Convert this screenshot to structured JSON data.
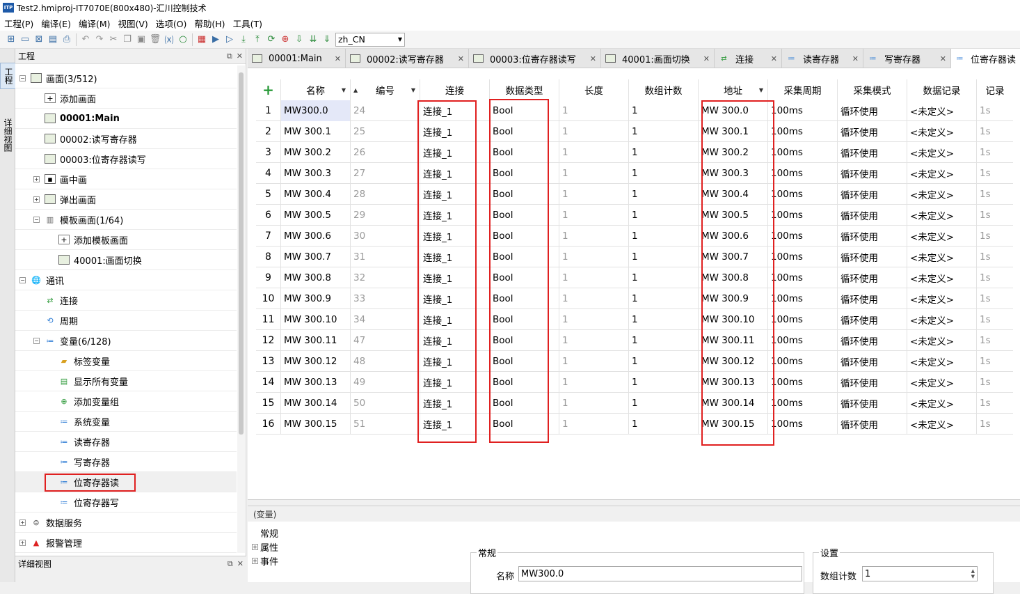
{
  "window": {
    "title": "Test2.hmiproj-IT7070E(800x480)-汇川控制技术",
    "logo_text": "ITP"
  },
  "menu": [
    "工程(P)",
    "编译(E)",
    "编译(M)",
    "视图(V)",
    "选项(O)",
    "帮助(H)",
    "工具(T)"
  ],
  "toolbar": {
    "language": "zh_CN"
  },
  "sidetabs": [
    "工程",
    "详细视图"
  ],
  "project_panel": {
    "title": "工程",
    "tree": [
      {
        "label": "画面(3/512)",
        "bold": false
      },
      {
        "label": "添加画面",
        "bold": false
      },
      {
        "label": "00001:Main",
        "bold": true
      },
      {
        "label": "00002:读写寄存器",
        "bold": false
      },
      {
        "label": "00003:位寄存器读写",
        "bold": false
      },
      {
        "label": "画中画",
        "bold": false
      },
      {
        "label": "弹出画面",
        "bold": false
      },
      {
        "label": "模板画面(1/64)",
        "bold": false
      },
      {
        "label": "添加模板画面",
        "bold": false
      },
      {
        "label": "40001:画面切换",
        "bold": false
      },
      {
        "label": "通讯",
        "bold": false
      },
      {
        "label": "连接",
        "bold": false
      },
      {
        "label": "周期",
        "bold": false
      },
      {
        "label": "变量(6/128)",
        "bold": false
      },
      {
        "label": "标签变量",
        "bold": false
      },
      {
        "label": "显示所有变量",
        "bold": false
      },
      {
        "label": "添加变量组",
        "bold": false
      },
      {
        "label": "系统变量",
        "bold": false
      },
      {
        "label": "读寄存器",
        "bold": false
      },
      {
        "label": "写寄存器",
        "bold": false
      },
      {
        "label": "位寄存器读",
        "bold": false
      },
      {
        "label": "位寄存器写",
        "bold": false
      },
      {
        "label": "数据服务",
        "bold": false
      },
      {
        "label": "报警管理",
        "bold": false
      }
    ]
  },
  "detail_panel": {
    "title": "详细视图"
  },
  "tabs": [
    {
      "label": "00001:Main"
    },
    {
      "label": "00002:读写寄存器"
    },
    {
      "label": "00003:位寄存器读写"
    },
    {
      "label": "40001:画面切换"
    },
    {
      "label": "连接"
    },
    {
      "label": "读寄存器"
    },
    {
      "label": "写寄存器"
    },
    {
      "label": "位寄存器读"
    }
  ],
  "grid": {
    "add_symbol": "+",
    "headers": [
      "名称",
      "编号",
      "连接",
      "数据类型",
      "长度",
      "数组计数",
      "地址",
      "采集周期",
      "采集模式",
      "数据记录",
      "记录"
    ],
    "rows": [
      [
        "1",
        "MW300.0",
        "24",
        "连接_1",
        "Bool",
        "1",
        "1",
        "MW 300.0",
        "100ms",
        "循环使用",
        "<未定义>",
        "1s"
      ],
      [
        "2",
        "MW 300.1",
        "25",
        "连接_1",
        "Bool",
        "1",
        "1",
        "MW 300.1",
        "100ms",
        "循环使用",
        "<未定义>",
        "1s"
      ],
      [
        "3",
        "MW 300.2",
        "26",
        "连接_1",
        "Bool",
        "1",
        "1",
        "MW 300.2",
        "100ms",
        "循环使用",
        "<未定义>",
        "1s"
      ],
      [
        "4",
        "MW 300.3",
        "27",
        "连接_1",
        "Bool",
        "1",
        "1",
        "MW 300.3",
        "100ms",
        "循环使用",
        "<未定义>",
        "1s"
      ],
      [
        "5",
        "MW 300.4",
        "28",
        "连接_1",
        "Bool",
        "1",
        "1",
        "MW 300.4",
        "100ms",
        "循环使用",
        "<未定义>",
        "1s"
      ],
      [
        "6",
        "MW 300.5",
        "29",
        "连接_1",
        "Bool",
        "1",
        "1",
        "MW 300.5",
        "100ms",
        "循环使用",
        "<未定义>",
        "1s"
      ],
      [
        "7",
        "MW 300.6",
        "30",
        "连接_1",
        "Bool",
        "1",
        "1",
        "MW 300.6",
        "100ms",
        "循环使用",
        "<未定义>",
        "1s"
      ],
      [
        "8",
        "MW 300.7",
        "31",
        "连接_1",
        "Bool",
        "1",
        "1",
        "MW 300.7",
        "100ms",
        "循环使用",
        "<未定义>",
        "1s"
      ],
      [
        "9",
        "MW 300.8",
        "32",
        "连接_1",
        "Bool",
        "1",
        "1",
        "MW 300.8",
        "100ms",
        "循环使用",
        "<未定义>",
        "1s"
      ],
      [
        "10",
        "MW 300.9",
        "33",
        "连接_1",
        "Bool",
        "1",
        "1",
        "MW 300.9",
        "100ms",
        "循环使用",
        "<未定义>",
        "1s"
      ],
      [
        "11",
        "MW 300.10",
        "34",
        "连接_1",
        "Bool",
        "1",
        "1",
        "MW 300.10",
        "100ms",
        "循环使用",
        "<未定义>",
        "1s"
      ],
      [
        "12",
        "MW 300.11",
        "47",
        "连接_1",
        "Bool",
        "1",
        "1",
        "MW 300.11",
        "100ms",
        "循环使用",
        "<未定义>",
        "1s"
      ],
      [
        "13",
        "MW 300.12",
        "48",
        "连接_1",
        "Bool",
        "1",
        "1",
        "MW 300.12",
        "100ms",
        "循环使用",
        "<未定义>",
        "1s"
      ],
      [
        "14",
        "MW 300.13",
        "49",
        "连接_1",
        "Bool",
        "1",
        "1",
        "MW 300.13",
        "100ms",
        "循环使用",
        "<未定义>",
        "1s"
      ],
      [
        "15",
        "MW 300.14",
        "50",
        "连接_1",
        "Bool",
        "1",
        "1",
        "MW 300.14",
        "100ms",
        "循环使用",
        "<未定义>",
        "1s"
      ],
      [
        "16",
        "MW 300.15",
        "51",
        "连接_1",
        "Bool",
        "1",
        "1",
        "MW 300.15",
        "100ms",
        "循环使用",
        "<未定义>",
        "1s"
      ]
    ]
  },
  "properties": {
    "title": "(变量)",
    "tree": [
      "常规",
      "属性",
      "事件"
    ],
    "general_group": "常规",
    "name_label": "名称",
    "name_value": "MW300.0",
    "settings_group": "设置",
    "array_count_label": "数组计数",
    "array_count_value": "1"
  }
}
